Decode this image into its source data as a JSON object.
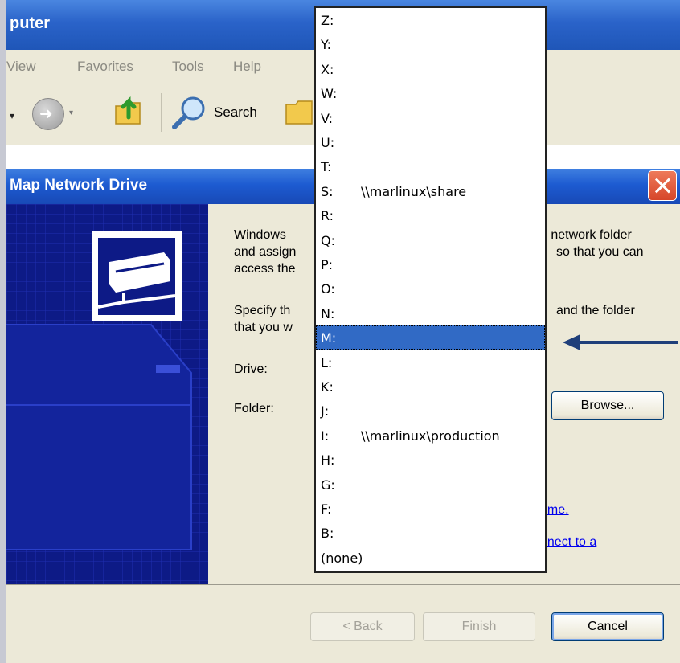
{
  "explorer": {
    "title": "puter",
    "menu": [
      "View",
      "Favorites",
      "Tools",
      "Help"
    ],
    "toolbar": {
      "search_label": "Search"
    }
  },
  "dialog": {
    "title": "Map Network Drive",
    "text1_line1": "Windows",
    "text1_line1_right": "d network folder",
    "text1_line2": "and assign",
    "text1_line2_right": "so that you can",
    "text1_line3": "access the",
    "text2_line1": "Specify th",
    "text2_line1_right": "and the folder",
    "text2_line2": "that you w",
    "drive_label": "Drive:",
    "folder_label": "Folder:",
    "browse_label": "Browse...",
    "link1": "ame.",
    "link2": "nnect to a",
    "back_label": "< Back",
    "finish_label": "Finish",
    "cancel_label": "Cancel"
  },
  "drive_list": [
    {
      "letter": "Z:",
      "path": ""
    },
    {
      "letter": "Y:",
      "path": ""
    },
    {
      "letter": "X:",
      "path": ""
    },
    {
      "letter": "W:",
      "path": ""
    },
    {
      "letter": "V:",
      "path": ""
    },
    {
      "letter": "U:",
      "path": ""
    },
    {
      "letter": "T:",
      "path": ""
    },
    {
      "letter": "S:",
      "path": "\\\\marlinux\\share"
    },
    {
      "letter": "R:",
      "path": ""
    },
    {
      "letter": "Q:",
      "path": ""
    },
    {
      "letter": "P:",
      "path": ""
    },
    {
      "letter": "O:",
      "path": ""
    },
    {
      "letter": "N:",
      "path": ""
    },
    {
      "letter": "M:",
      "path": ""
    },
    {
      "letter": "L:",
      "path": ""
    },
    {
      "letter": "K:",
      "path": ""
    },
    {
      "letter": "J:",
      "path": ""
    },
    {
      "letter": "I:",
      "path": "\\\\marlinux\\production"
    },
    {
      "letter": "H:",
      "path": ""
    },
    {
      "letter": "G:",
      "path": ""
    },
    {
      "letter": "F:",
      "path": ""
    },
    {
      "letter": "B:",
      "path": ""
    },
    {
      "letter": "(none)",
      "path": ""
    }
  ],
  "selected_drive": "M:",
  "colors": {
    "selection": "#316ac5",
    "title_bar": "#1d5bd1",
    "side_panel": "#0e1b8a",
    "arrow": "#1f3f7a"
  }
}
